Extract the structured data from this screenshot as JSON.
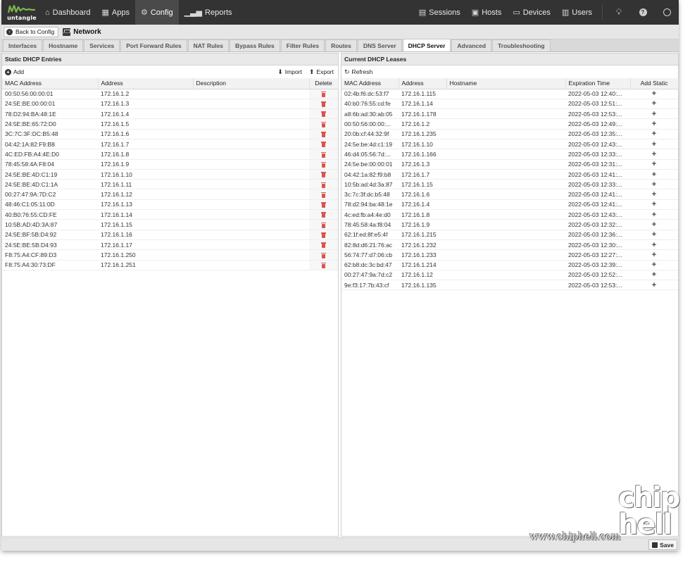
{
  "nav": {
    "logo_text": "untangle",
    "left_items": [
      {
        "icon": "home-icon",
        "label": "Dashboard"
      },
      {
        "icon": "grid-icon",
        "label": "Apps"
      },
      {
        "icon": "gear-icon",
        "label": "Config"
      },
      {
        "icon": "chart-icon",
        "label": "Reports"
      }
    ],
    "right_items": [
      {
        "icon": "sessions-icon",
        "label": "Sessions"
      },
      {
        "icon": "hosts-icon",
        "label": "Hosts"
      },
      {
        "icon": "monitor-icon",
        "label": "Devices"
      },
      {
        "icon": "users-icon",
        "label": "Users"
      }
    ],
    "active": "Config"
  },
  "breadcrumb": {
    "back_label": "Back to Config",
    "title": "Network"
  },
  "tabs": [
    "Interfaces",
    "Hostname",
    "Services",
    "Port Forward Rules",
    "NAT Rules",
    "Bypass Rules",
    "Filter Rules",
    "Routes",
    "DNS Server",
    "DHCP Server",
    "Advanced",
    "Troubleshooting"
  ],
  "active_tab": "DHCP Server",
  "static_panel": {
    "title": "Static DHCP Entries",
    "add_label": "Add",
    "import_label": "Import",
    "export_label": "Export",
    "columns": [
      "MAC Address",
      "Address",
      "Description",
      "Delete"
    ],
    "rows": [
      [
        "00:50:56:00:00:01",
        "172.16.1.2"
      ],
      [
        "24:5E:BE:00:00:01",
        "172.16.1.3"
      ],
      [
        "78:D2:94:BA:48:1E",
        "172.16.1.4"
      ],
      [
        "24:5E:BE:65:72:D0",
        "172.16.1.5"
      ],
      [
        "3C:7C:3F:DC:B5:48",
        "172.16.1.6"
      ],
      [
        "04:42:1A:82:F9:B8",
        "172.16.1.7"
      ],
      [
        "4C:ED:FB:A4:4E:D0",
        "172.16.1.8"
      ],
      [
        "78:45:58:4A:F8:04",
        "172.16.1.9"
      ],
      [
        "24:5E:BE:4D:C1:19",
        "172.16.1.10"
      ],
      [
        "24:5E:BE:4D:C1:1A",
        "172.16.1.11"
      ],
      [
        "00:27:47:9A:7D:C2",
        "172.16.1.12"
      ],
      [
        "48:46:C1:05:11:0D",
        "172.16.1.13"
      ],
      [
        "40:B0:76:55:CD:FE",
        "172.16.1.14"
      ],
      [
        "10:5B:AD:4D:3A:87",
        "172.16.1.15"
      ],
      [
        "24:5E:BF:5B:D4:92",
        "172.16.1.16"
      ],
      [
        "24:5E:BE:5B:D4:93",
        "172.16.1.17"
      ],
      [
        "F8:75:A4:CF:89:D3",
        "172.16.1.250"
      ],
      [
        "F8:75:A4:30:73:DF",
        "172.16.1.251"
      ]
    ]
  },
  "leases_panel": {
    "title": "Current DHCP Leases",
    "refresh_label": "Refresh",
    "columns": [
      "MAC Address",
      "Address",
      "Hostname",
      "Expiration Time",
      "Add Static"
    ],
    "rows": [
      [
        "02:4b:f6:dc:53:f7",
        "172.16.1.115",
        "2022-05-03 12:40:..."
      ],
      [
        "40:b0:76:55:cd:fe",
        "172.16.1.14",
        "2022-05-03 12:51:..."
      ],
      [
        "a8:6b:ad:30:ab:05",
        "172.16.1.178",
        "2022-05-03 12:53:..."
      ],
      [
        "00:50:56:00:00:...",
        "172.16.1.2",
        "2022-05-03 12:49:..."
      ],
      [
        "20:0b:cf:44:32:9f",
        "172.16.1.235",
        "2022-05-03 12:35:..."
      ],
      [
        "24:5e:be:4d:c1:19",
        "172.16.1.10",
        "2022-05-03 12:43:..."
      ],
      [
        "46:d4:05:56:7d:...",
        "172.16.1.166",
        "2022-05-03 12:33:..."
      ],
      [
        "24:5e:be:00:00:01",
        "172.16.1.3",
        "2022-05-03 12:31:..."
      ],
      [
        "04:42:1a:82:f9:b8",
        "172.16.1.7",
        "2022-05-03 12:41:..."
      ],
      [
        "10:5b:ad:4d:3a:87",
        "172.16.1.15",
        "2022-05-03 12:33:..."
      ],
      [
        "3c:7c:3f:dc:b5:48",
        "172.16.1.6",
        "2022-05-03 12:41:..."
      ],
      [
        "78:d2:94:ba:48:1e",
        "172.16.1.4",
        "2022-05-03 12:41:..."
      ],
      [
        "4c:ed:fb:a4:4e:d0",
        "172.16.1.8",
        "2022-05-03 12:43:..."
      ],
      [
        "78:45:58:4a:f8:04",
        "172.16.1.9",
        "2022-05-03 12:32:..."
      ],
      [
        "62:1f:ed:8f:e5:4f",
        "172.16.1.215",
        "2022-05-03 12:36:..."
      ],
      [
        "82:8d:d6:21:76:ac",
        "172.16.1.232",
        "2022-05-03 12:30:..."
      ],
      [
        "56:74:77:d7:06:cb",
        "172.16.1.233",
        "2022-05-03 12:27:..."
      ],
      [
        "62:b8:dc:3c:bd:47",
        "172.16.1.214",
        "2022-05-03 12:39:..."
      ],
      [
        "00:27:47:9a:7d:c2",
        "172.16.1.12",
        "2022-05-03 12:52:..."
      ],
      [
        "9e:f3:17:7b:43:cf",
        "172.16.1.135",
        "2022-05-03 12:53:..."
      ]
    ]
  },
  "footer": {
    "save_label": "Save"
  },
  "watermark": {
    "logo": "chip hell",
    "url": "www.chiphell.com"
  },
  "colors": {
    "nav_bg": "#333333",
    "delete": "#d9534f"
  }
}
